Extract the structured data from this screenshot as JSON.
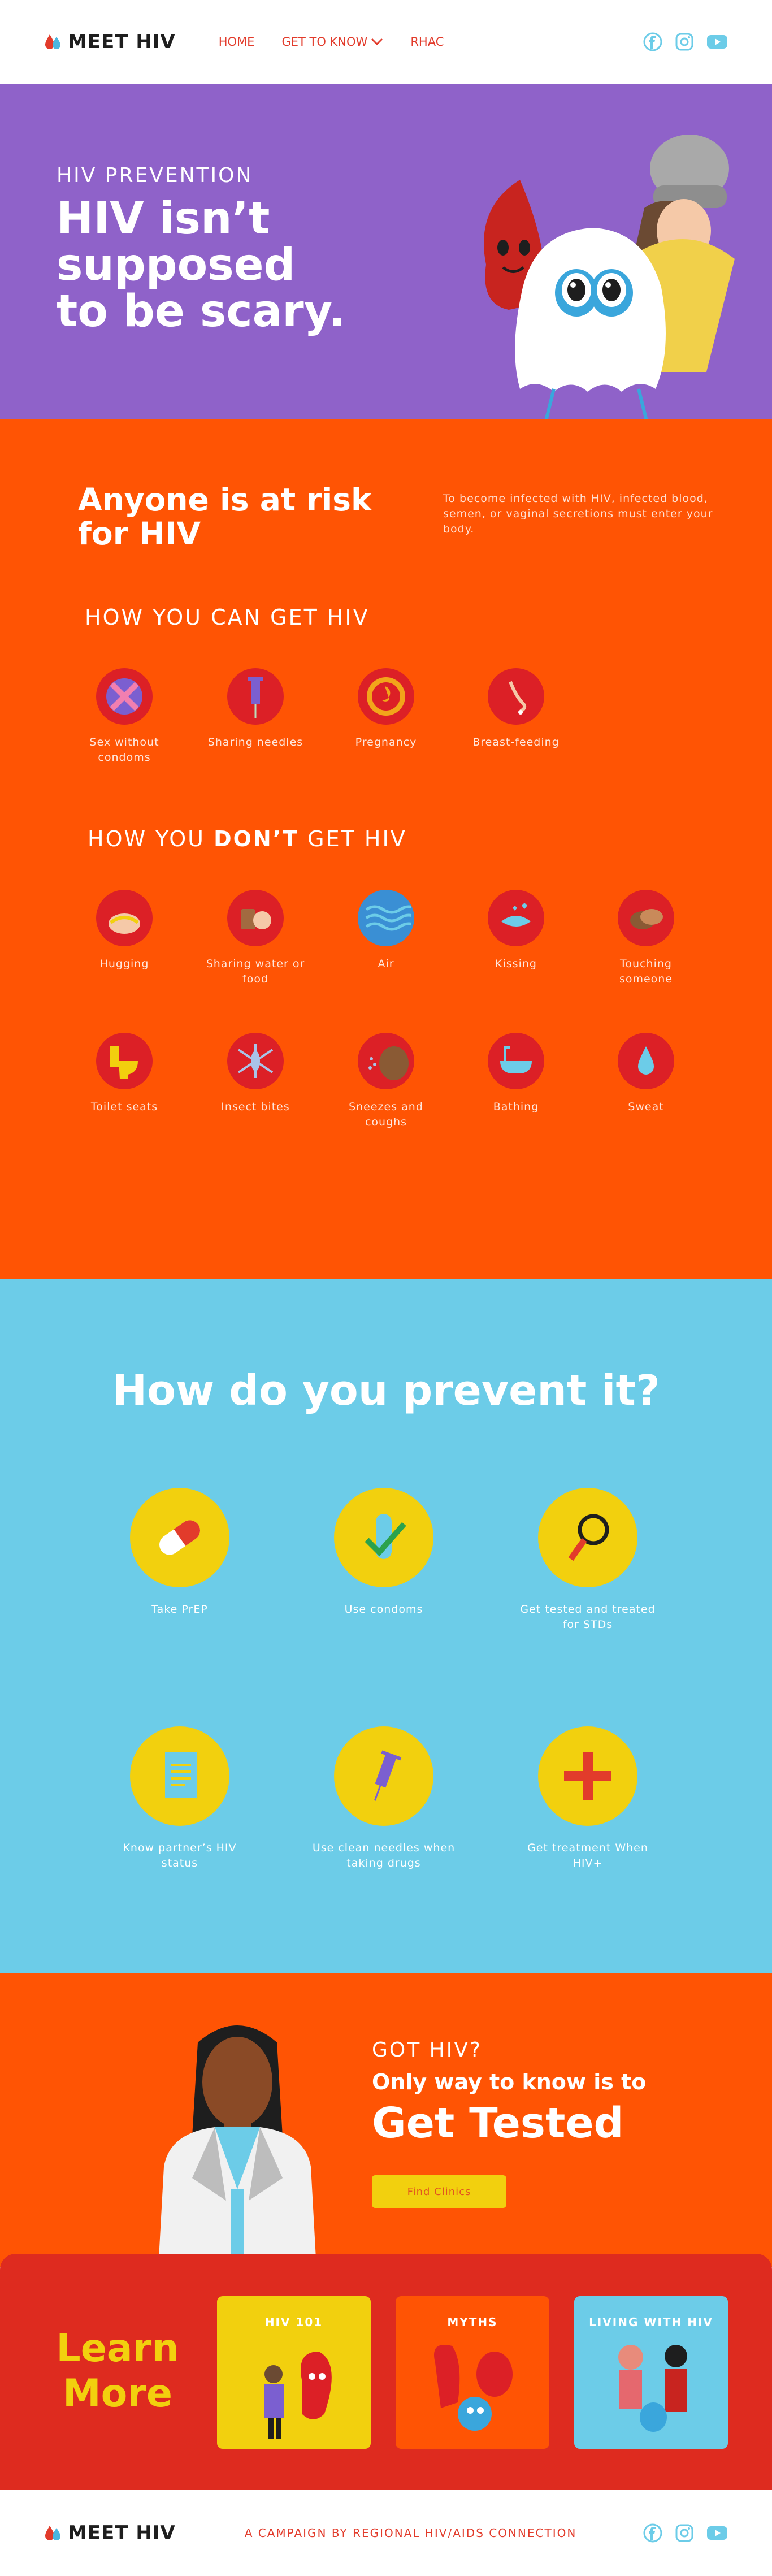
{
  "header": {
    "logo": "MEET HIV",
    "nav": [
      "HOME",
      "GET TO KNOW",
      "RHAC"
    ]
  },
  "hero": {
    "kicker": "HIV PREVENTION",
    "title": "HIV isn’t supposed to be scary."
  },
  "risk": {
    "title": "Anyone is at risk for HIV",
    "text": "To become infected with HIV, infected blood, semen, or vaginal secretions must enter your body."
  },
  "can": {
    "heading": "HOW YOU CAN GET HIV",
    "items": [
      "Sex without condoms",
      "Sharing needles",
      "Pregnancy",
      "Breast-feeding"
    ]
  },
  "dont": {
    "heading_a": "HOW YOU ",
    "heading_b": "DON’T",
    "heading_c": " GET HIV",
    "items": [
      "Hugging",
      "Sharing water or food",
      "Air",
      "Kissing",
      "Touching someone",
      "Toilet seats",
      "Insect bites",
      "Sneezes and coughs",
      "Bathing",
      "Sweat"
    ]
  },
  "prevent": {
    "title": "How do you prevent it?",
    "items": [
      "Take PrEP",
      "Use condoms",
      "Get tested and treated for STDs",
      "Know partner’s HIV status",
      "Use clean needles when taking drugs",
      "Get treatment When HIV+"
    ]
  },
  "tested": {
    "kicker": "GOT HIV?",
    "sub": "Only way to know is to",
    "title": "Get Tested",
    "button": "Find Clinics"
  },
  "learn": {
    "title": "Learn More",
    "cards": [
      "HIV 101",
      "MYTHS",
      "LIVING WITH HIV"
    ]
  },
  "footer": {
    "logo": "MEET HIV",
    "campaign": "A CAMPAIGN BY REGIONAL HIV/AIDS CONNECTION"
  },
  "colors": {
    "purple": "#8f62c9",
    "orange": "#ff5404",
    "blue": "#6ccce8",
    "red": "#de2b1f",
    "yellow": "#f2d00e"
  }
}
